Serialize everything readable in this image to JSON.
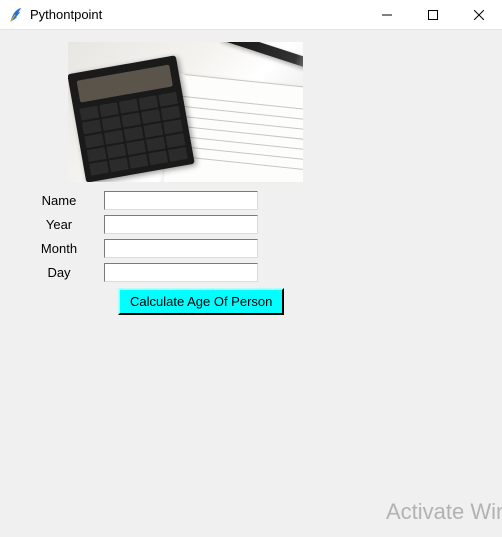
{
  "window": {
    "title": "Pythontpoint"
  },
  "form": {
    "labels": {
      "name": "Name",
      "year": "Year",
      "month": "Month",
      "day": "Day"
    },
    "values": {
      "name": "",
      "year": "",
      "month": "",
      "day": ""
    },
    "button_label": "Calculate Age Of Person"
  },
  "watermark": {
    "line1": "Activate Windows"
  }
}
